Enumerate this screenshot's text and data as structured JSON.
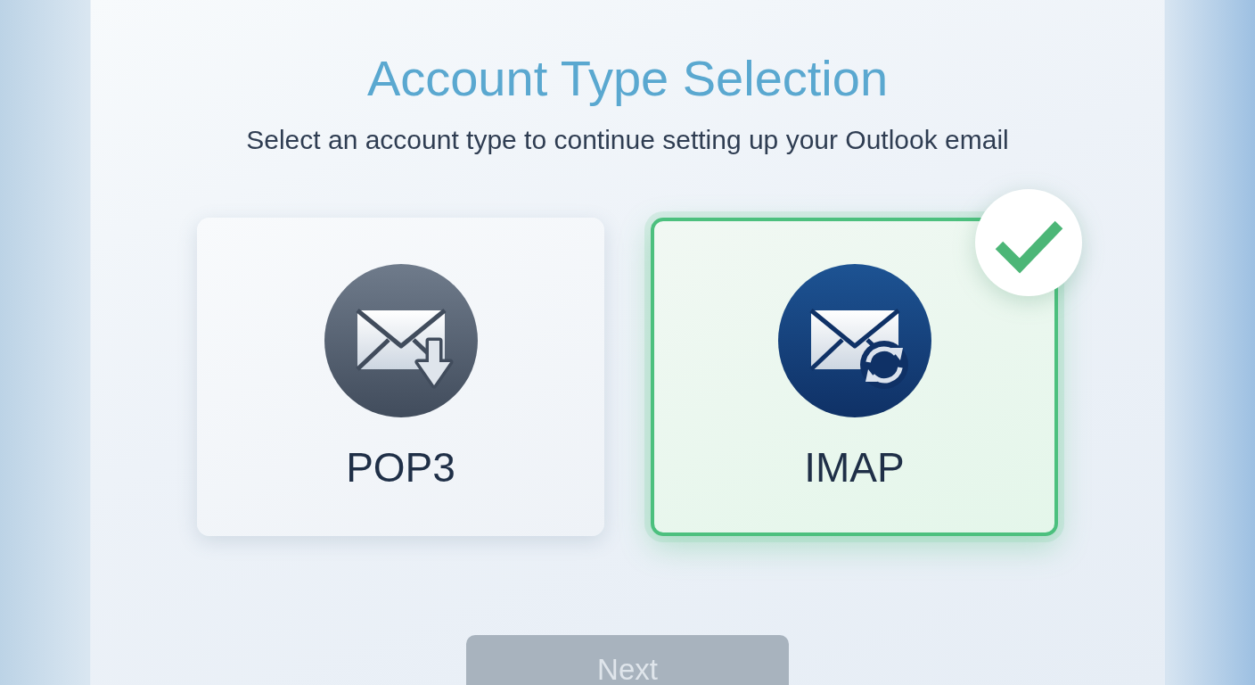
{
  "title": "Account Type Selection",
  "subtitle": "Select an account type to continue setting up your Outlook email",
  "options": [
    {
      "kind": "download",
      "label": "POP3",
      "selected": false
    },
    {
      "kind": "sync",
      "label": "IMAP",
      "selected": true
    }
  ],
  "next_button": {
    "label": "Next",
    "disabled": true
  }
}
